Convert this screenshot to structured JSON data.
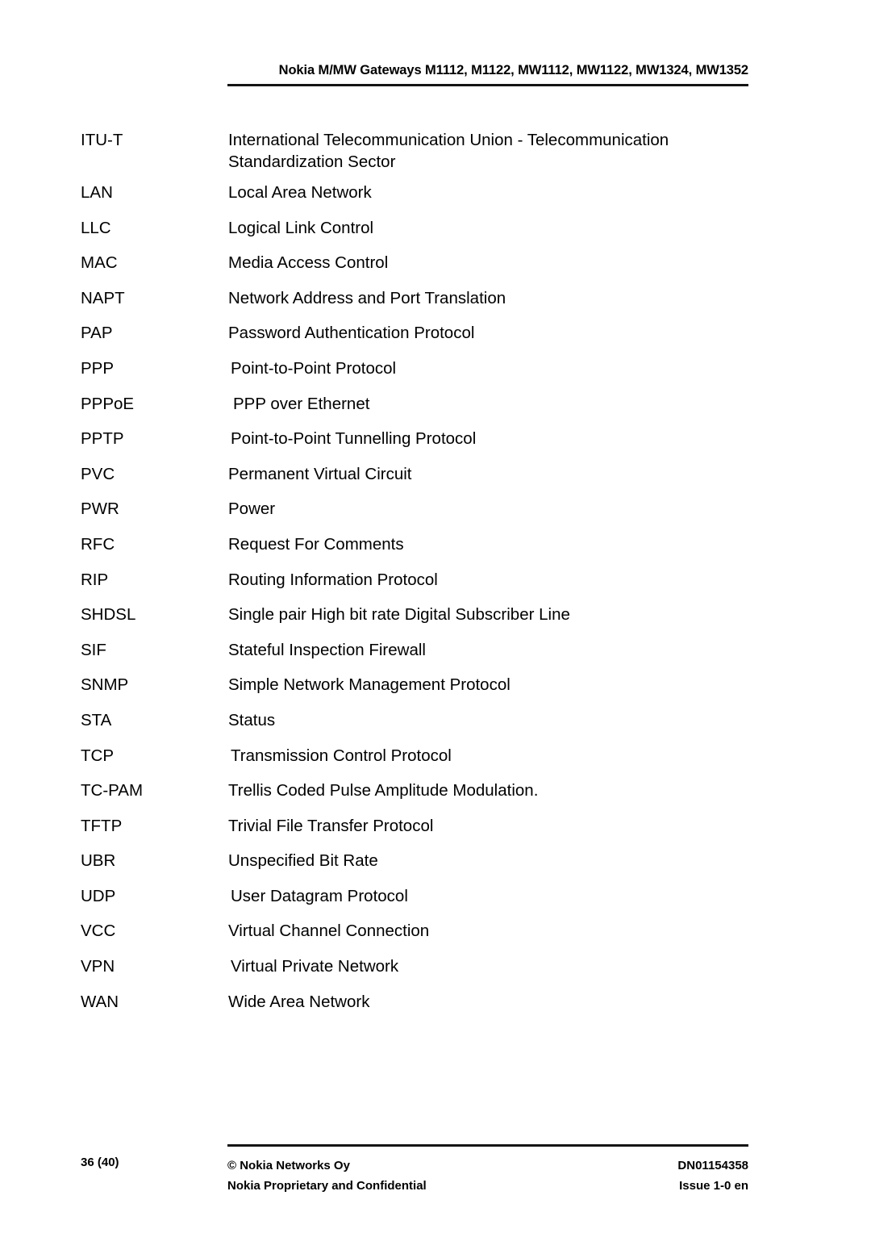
{
  "header": {
    "title": "Nokia M/MW Gateways M1112, M1122, MW1112, MW1122, MW1324, MW1352"
  },
  "glossary": {
    "entries": [
      {
        "term": "ITU-T",
        "definition": "International Telecommunication Union - Telecommunication Standardization Sector",
        "indent": 0,
        "tall": true
      },
      {
        "term": "LAN",
        "definition": "Local Area Network",
        "indent": 0,
        "tall": false
      },
      {
        "term": "LLC",
        "definition": "Logical Link Control",
        "indent": 0,
        "tall": false
      },
      {
        "term": "MAC",
        "definition": "Media Access Control",
        "indent": 0,
        "tall": false
      },
      {
        "term": "NAPT",
        "definition": "Network Address and Port Translation",
        "indent": 0,
        "tall": false
      },
      {
        "term": "PAP",
        "definition": "Password Authentication Protocol",
        "indent": 0,
        "tall": false
      },
      {
        "term": "PPP",
        "definition": "Point-to-Point Protocol",
        "indent": 1,
        "tall": false
      },
      {
        "term": "PPPoE",
        "definition": "PPP over Ethernet",
        "indent": 2,
        "tall": false
      },
      {
        "term": "PPTP",
        "definition": "Point-to-Point Tunnelling Protocol",
        "indent": 1,
        "tall": false
      },
      {
        "term": "PVC",
        "definition": "Permanent Virtual Circuit",
        "indent": 0,
        "tall": false
      },
      {
        "term": "PWR",
        "definition": "Power",
        "indent": 0,
        "tall": false
      },
      {
        "term": "RFC",
        "definition": "Request For Comments",
        "indent": 0,
        "tall": false
      },
      {
        "term": "RIP",
        "definition": "Routing Information Protocol",
        "indent": 0,
        "tall": false
      },
      {
        "term": "SHDSL",
        "definition": "Single pair High bit rate Digital Subscriber Line",
        "indent": 0,
        "tall": false
      },
      {
        "term": "SIF",
        "definition": "Stateful Inspection Firewall",
        "indent": 0,
        "tall": false
      },
      {
        "term": "SNMP",
        "definition": "Simple Network Management Protocol",
        "indent": 0,
        "tall": false
      },
      {
        "term": "STA",
        "definition": "Status",
        "indent": 0,
        "tall": false
      },
      {
        "term": "TCP",
        "definition": "Transmission Control Protocol",
        "indent": 1,
        "tall": false
      },
      {
        "term": "TC-PAM",
        "definition": "Trellis Coded Pulse Amplitude Modulation.",
        "indent": 0,
        "tall": false
      },
      {
        "term": "TFTP",
        "definition": "Trivial File Transfer Protocol",
        "indent": 0,
        "tall": false
      },
      {
        "term": "UBR",
        "definition": "Unspecified Bit Rate",
        "indent": 0,
        "tall": false
      },
      {
        "term": "UDP",
        "definition": "User Datagram Protocol",
        "indent": 1,
        "tall": false
      },
      {
        "term": "VCC",
        "definition": "Virtual Channel Connection",
        "indent": 0,
        "tall": false
      },
      {
        "term": "VPN",
        "definition": "Virtual Private Network",
        "indent": 1,
        "tall": false
      },
      {
        "term": "WAN",
        "definition": "Wide Area Network",
        "indent": 0,
        "tall": false
      }
    ]
  },
  "footer": {
    "page_number": "36 (40)",
    "copyright": "© Nokia Networks Oy",
    "confidentiality": "Nokia Proprietary and Confidential",
    "document_id": "DN01154358",
    "issue": "Issue 1-0 en"
  }
}
